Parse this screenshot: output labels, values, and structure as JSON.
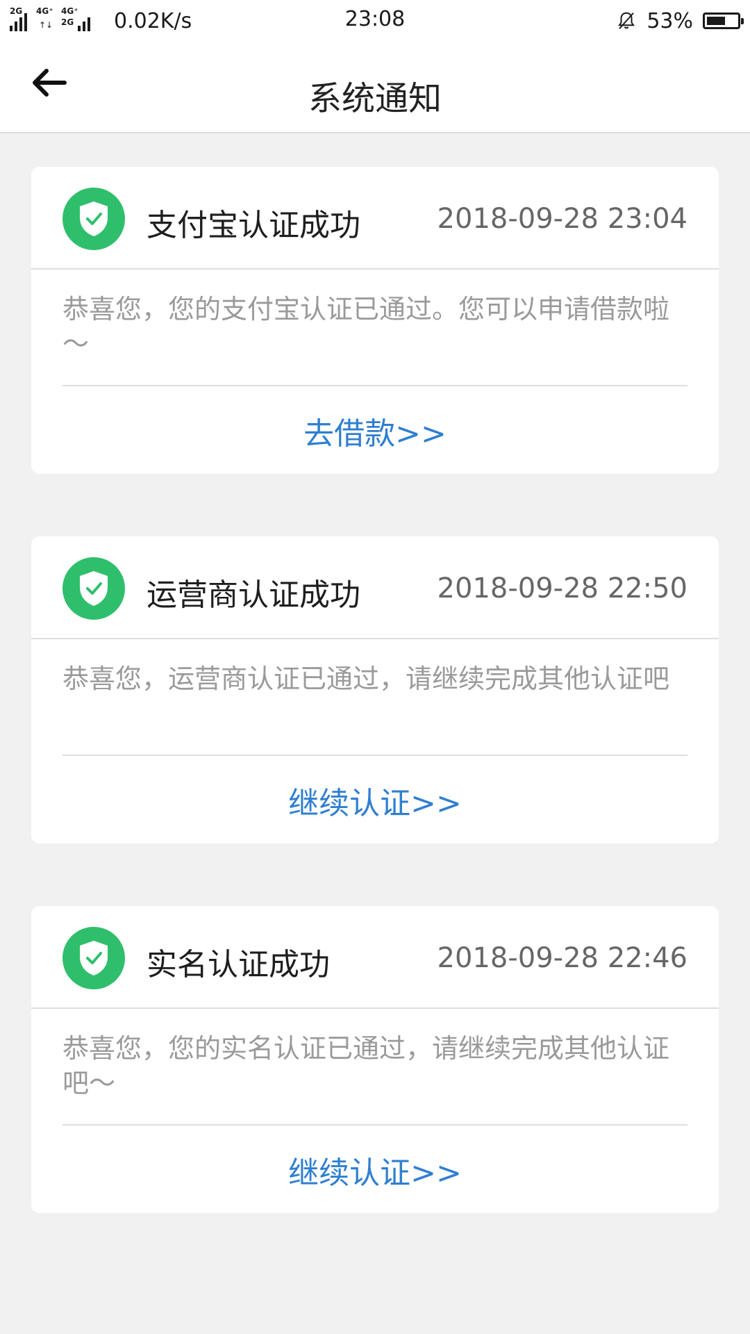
{
  "status_bar": {
    "net1": "2G",
    "net2": "4G⁺",
    "net3": "4G⁺",
    "net4": "2G",
    "speed": "0.02K/s",
    "time": "23:08",
    "battery": "53%"
  },
  "header": {
    "title": "系统通知",
    "back_icon": "back-arrow-icon"
  },
  "notifications": [
    {
      "title": "支付宝认证成功",
      "time": "2018-09-28 23:04",
      "body": "恭喜您，您的支付宝认证已通过。您可以申请借款啦～",
      "action": "去借款>>",
      "icon": "shield-check-icon"
    },
    {
      "title": "运营商认证成功",
      "time": "2018-09-28 22:50",
      "body": "恭喜您，运营商认证已通过，请继续完成其他认证吧",
      "action": "继续认证>>",
      "icon": "shield-check-icon"
    },
    {
      "title": "实名认证成功",
      "time": "2018-09-28 22:46",
      "body": "恭喜您，您的实名认证已通过，请继续完成其他认证吧～",
      "action": "继续认证>>",
      "icon": "shield-check-icon"
    }
  ],
  "colors": {
    "badge": "#2fbf6c",
    "action": "#2f7fd0",
    "background": "#f1f1f1"
  }
}
